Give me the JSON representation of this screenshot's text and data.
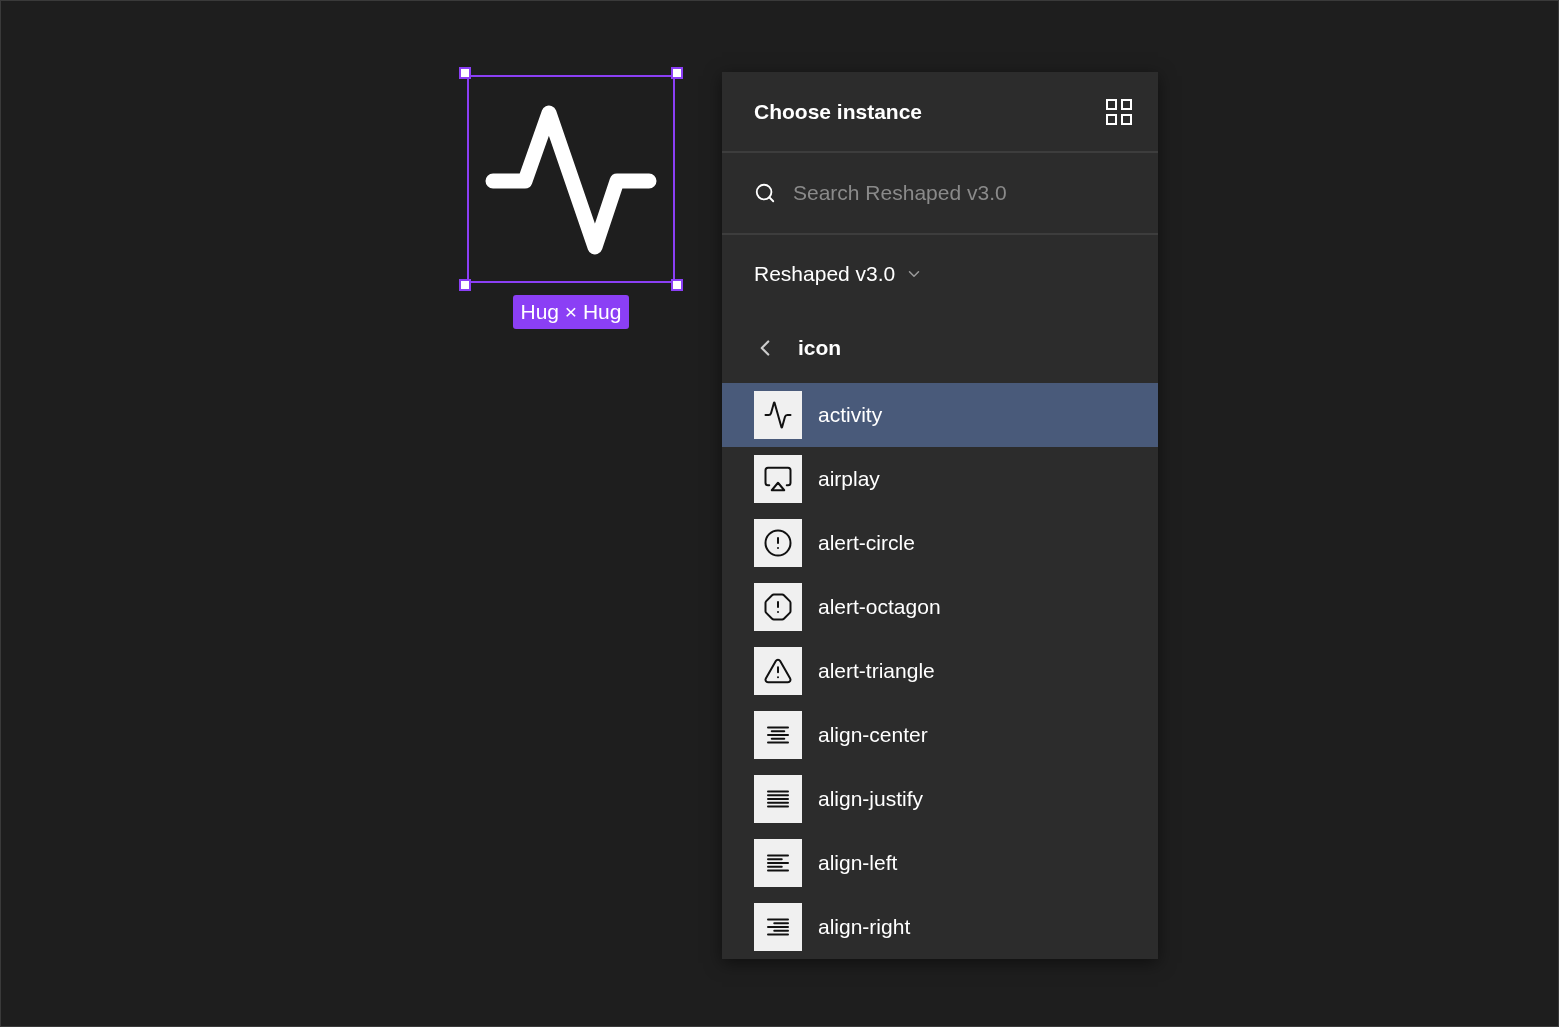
{
  "canvas": {
    "size_label": "Hug × Hug"
  },
  "panel": {
    "title": "Choose instance",
    "search": {
      "placeholder": "Search Reshaped v3.0"
    },
    "library": {
      "label": "Reshaped v3.0"
    },
    "folder": {
      "label": "icon"
    },
    "items": [
      {
        "label": "activity",
        "kind": "pulse",
        "selected": true
      },
      {
        "label": "airplay",
        "kind": "screen",
        "selected": false
      },
      {
        "label": "alert-circle",
        "kind": "circle",
        "selected": false
      },
      {
        "label": "alert-octagon",
        "kind": "octagon",
        "selected": false
      },
      {
        "label": "alert-triangle",
        "kind": "triangle",
        "selected": false
      },
      {
        "label": "align-center",
        "kind": "center",
        "selected": false
      },
      {
        "label": "align-justify",
        "kind": "justify",
        "selected": false
      },
      {
        "label": "align-left",
        "kind": "left",
        "selected": false
      },
      {
        "label": "align-right",
        "kind": "right",
        "selected": false
      }
    ]
  }
}
